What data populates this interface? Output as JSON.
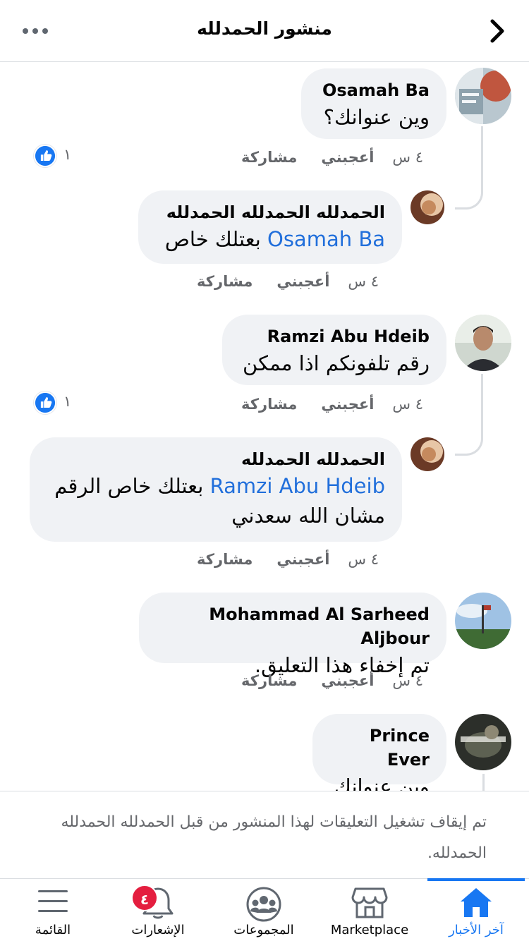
{
  "header": {
    "title": "منشور الحمدلله",
    "back_icon": "chevron-right-icon",
    "more_icon": "more-horizontal-icon"
  },
  "comments": [
    {
      "author": "Osamah Ba",
      "text": "وين عنوانك؟",
      "time": "٤ س",
      "like_label": "أعجبني",
      "share_label": "مشاركة",
      "reaction_count": "١",
      "reply": {
        "author": "الحمدلله الحمدلله الحمدلله",
        "mention": "Osamah Ba",
        "text": "بعتلك خاص",
        "time": "٤ س",
        "like_label": "أعجبني",
        "share_label": "مشاركة"
      }
    },
    {
      "author": "Ramzi Abu Hdeib",
      "text": "رقم تلفونكم اذا ممكن",
      "time": "٤ س",
      "like_label": "أعجبني",
      "share_label": "مشاركة",
      "reaction_count": "١",
      "reply": {
        "author": "الحمدلله الحمدلله",
        "mention": "Ramzi Abu Hdeib",
        "text_line1": "بعتلك خاص الرقم",
        "text_line2": "مشان الله سعدني",
        "time": "٤ س",
        "like_label": "أعجبني",
        "share_label": "مشاركة"
      }
    },
    {
      "author": "Mohammad Al Sarheed Aljbour",
      "text": "تم إخفاء هذا التعليق.",
      "time": "٤ س",
      "like_label": "أعجبني",
      "share_label": "مشاركة"
    },
    {
      "author": "Prince Ever",
      "text": "وين عنوانك"
    }
  ],
  "notice": {
    "text": "تم إيقاف تشغيل التعليقات لهذا المنشور من قبل الحمدلله الحمدلله الحمدلله."
  },
  "tabbar": {
    "tabs": [
      {
        "label": "آخر الأخبار",
        "icon": "home-icon",
        "active": true
      },
      {
        "label": "Marketplace",
        "icon": "marketplace-icon"
      },
      {
        "label": "المجموعات",
        "icon": "groups-icon"
      },
      {
        "label": "الإشعارات",
        "icon": "bell-icon",
        "badge": "٤"
      },
      {
        "label": "القائمة",
        "icon": "menu-icon"
      }
    ]
  },
  "colors": {
    "accent": "#1877f2",
    "mention": "#216fdb",
    "bubble": "#f0f2f5",
    "muted": "#65676b",
    "badge": "#e41e3f"
  }
}
